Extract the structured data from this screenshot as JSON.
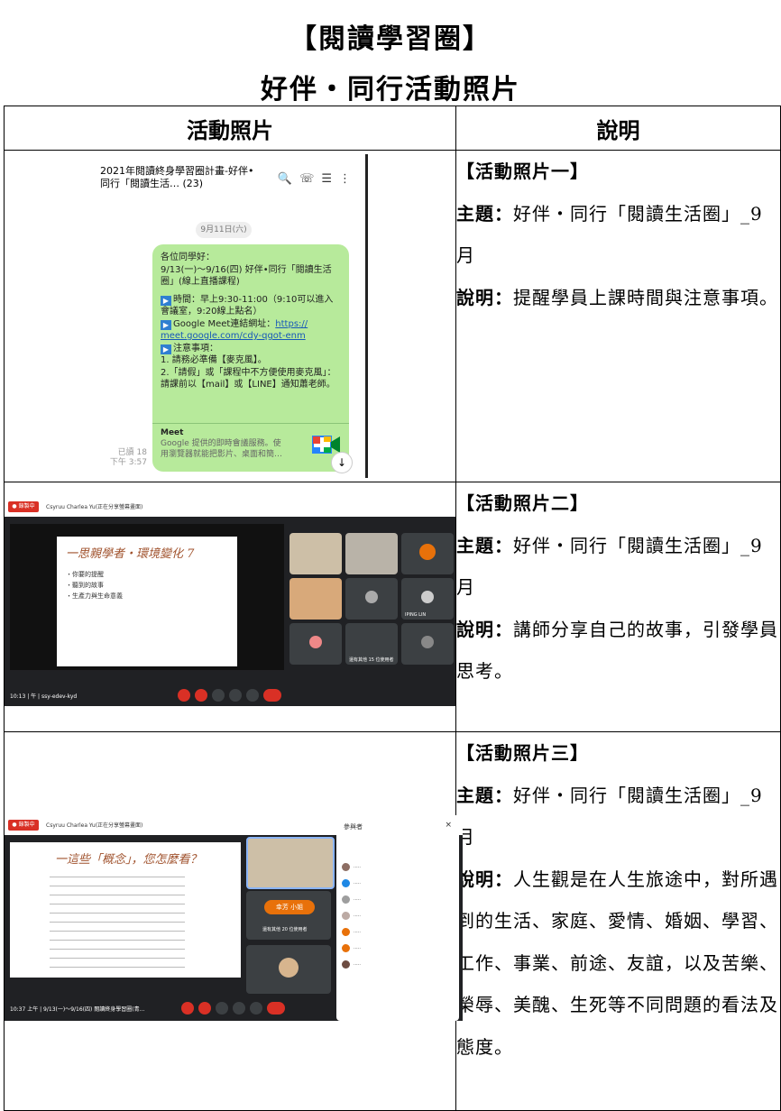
{
  "titles": {
    "main": "【閱讀學習圈】",
    "sub": "好伴・同行活動照片"
  },
  "table": {
    "header_photo": "活動照片",
    "header_desc": "說明"
  },
  "rows": [
    {
      "label": "【活動照片一】",
      "theme_label": "主題：",
      "theme": "好伴・同行「閱讀生活圈」_9 月",
      "desc_label": "說明：",
      "desc": "提醒學員上課時間與注意事項。"
    },
    {
      "label": "【活動照片二】",
      "theme_label": "主題：",
      "theme": "好伴・同行「閱讀生活圈」_9 月",
      "desc_label": "說明：",
      "desc": "講師分享自己的故事，引發學員思考。"
    },
    {
      "label": "【活動照片三】",
      "theme_label": "主題：",
      "theme": "好伴・同行「閱讀生活圈」_9 月",
      "desc_label": "說明：",
      "desc": "人生觀是在人生旅途中，對所遇到的生活、家庭、愛情、婚姻、學習、工作、事業、前途、友誼，以及苦樂、榮辱、美醜、生死等不同問題的看法及態度。"
    }
  ],
  "chat": {
    "group_title": "2021年閱讀終身學習圈計畫-好伴•同行「閱讀生活… (23)",
    "date": "9月11日(六)",
    "lines": [
      "各位同學好：",
      "9/13(一)～9/16(四) 好伴•同行「閱讀生活圈」(線上直播課程)",
      "時間：早上9:30-11:00（9:10可以進入會議室，9:20線上點名）",
      "Google Meet連結網址：",
      "meet.google.com/cdy-qgot-enm",
      "注意事項：",
      "1. 請務必準備【麥克風】。",
      "2.「請假」或「課程中不方便使用麥克風」：請課前以【mail】或【LINE】通知蕭老師。"
    ],
    "link_prefix": "https://",
    "meet_title": "Meet",
    "meet_text": "Google 提供的即時會議服務。使用瀏覽器就能把影片、桌面和簡…",
    "read": "已讀 18",
    "time": "下午 3:57"
  },
  "meet1": {
    "presenter": "Csyruu Charlea Yu(正在分享螢幕畫面)",
    "slide_title": "一思親學者・環境變化 7",
    "bullets": [
      "・你要的提醒",
      "・聽到的故事",
      "・生產力與生命意義"
    ],
    "time_code": "10:13 | 午 | ssy-edev-kyd",
    "names": [
      "IPING LIN",
      "還有其他 15 位使用者"
    ]
  },
  "meet2": {
    "presenter": "Csyruu Charlea Yu(正在分享螢幕畫面)",
    "slide_title": "一這些「概念」，您怎麼看？",
    "time_code": "10:37 上午 | 9/13(一)～9/16(四) 閱讀終身學習圈(青…",
    "panel_title": "參與者",
    "others": "還有其他 20 位使用者",
    "badge": "幸芳 小姐"
  },
  "colors": {
    "bubble": "#b7ea9b",
    "meet_bg": "#202124",
    "record": "#d93025"
  }
}
